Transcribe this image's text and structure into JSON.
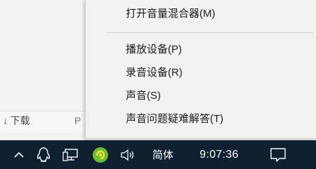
{
  "context_menu": {
    "items": [
      {
        "label": "打开音量混合器(M)"
      },
      {
        "label": "播放设备(P)"
      },
      {
        "label": "录音设备(R)"
      },
      {
        "label": "声音(S)"
      },
      {
        "label": "声音问题疑难解答(T)"
      }
    ]
  },
  "background_window": {
    "download_label": "下载",
    "partial_label": "P"
  },
  "taskbar": {
    "tray_icons": [
      "chevron-up-icon",
      "qq-penguin-icon",
      "network-icon",
      "green-app-icon",
      "volume-icon"
    ],
    "ime_label": "简体",
    "clock": "9:07:36",
    "accent_color": "#0f2030"
  },
  "colors": {
    "menu_background": "#f2f2f2",
    "taskbar_background": "#0f2030",
    "green_app": "#6dbd2d"
  }
}
